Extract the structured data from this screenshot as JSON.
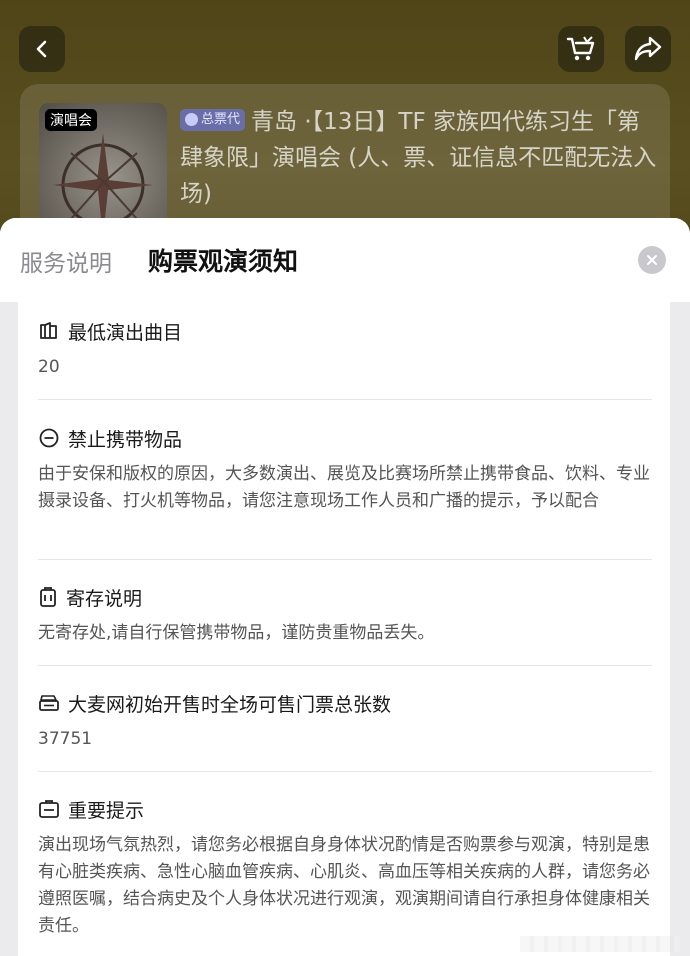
{
  "header": {
    "poster_tag": "演唱会",
    "agent_badge": "总票代",
    "event_title": "青岛 ·【13日】TF 家族四代练习生「第肆象限」演唱会 (人、票、证信息不匹配无法入场)"
  },
  "sheet": {
    "tabs": [
      "服务说明",
      "购票观演须知"
    ],
    "active_tab": "购票观演须知"
  },
  "sections": [
    {
      "icon": "music-note-icon",
      "title": "最低演出曲目",
      "body": "20"
    },
    {
      "icon": "prohibited-icon",
      "title": "禁止携带物品",
      "body": "由于安保和版权的原因，大多数演出、展览及比赛场所禁止携带食品、饮料、专业摄录设备、打火机等物品，请您注意现场工作人员和广播的提示，予以配合"
    },
    {
      "icon": "locker-icon",
      "title": "寄存说明",
      "body": "无寄存处,请自行保管携带物品，谨防贵重物品丢失。"
    },
    {
      "icon": "ticket-stack-icon",
      "title": "大麦网初始开售时全场可售门票总张数",
      "body": "37751"
    },
    {
      "icon": "notice-icon",
      "title": "重要提示",
      "body": "演出现场气氛热烈，请您务必根据自身身体状况酌情是否购票参与观演，特别是患有心脏类疾病、急性心脑血管疾病、心肌炎、高血压等相关疾病的人群，请您务必遵照医嘱，结合病史及个人身体状况进行观演，观演期间请自行承担身体健康相关责任。"
    }
  ],
  "colors": {
    "header_bg": "#5a4f20",
    "sheet_bg": "#ebebed",
    "badge_bg": "#6a6ea8"
  }
}
